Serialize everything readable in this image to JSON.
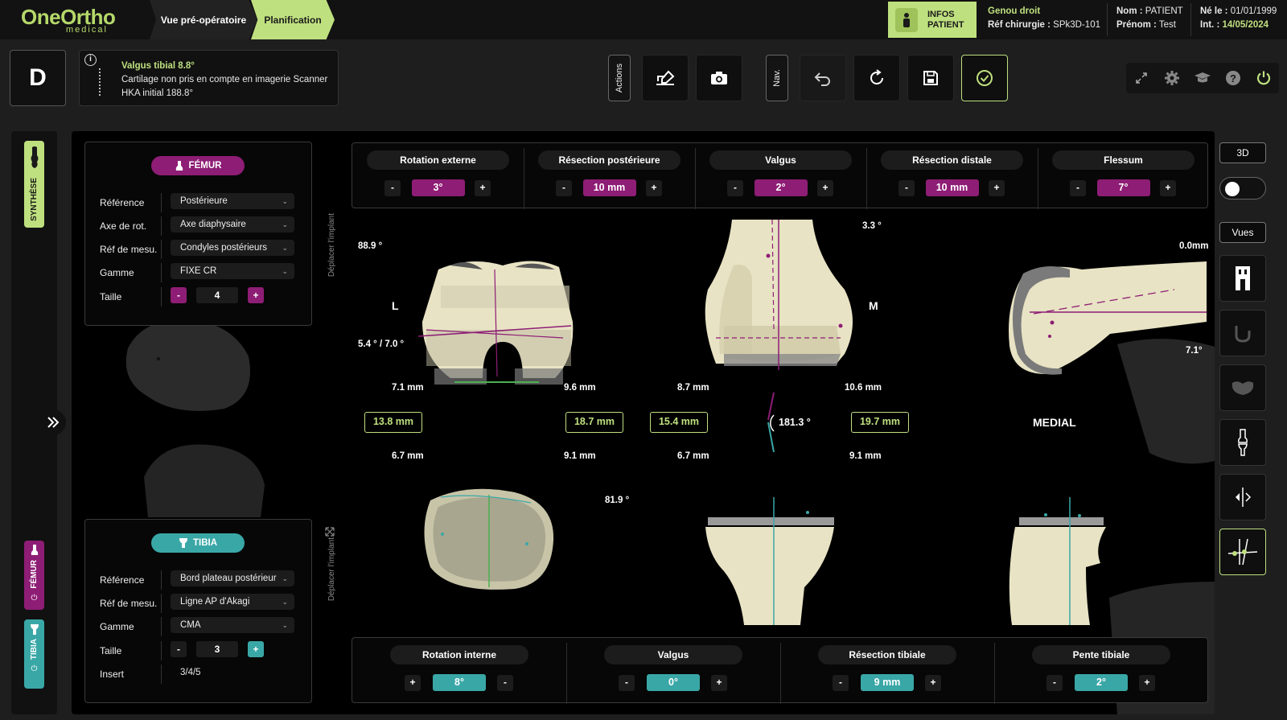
{
  "header": {
    "logo": "OneOrtho",
    "logo_sub": "medical",
    "tabs": [
      {
        "label": "Vue pré-opératoire",
        "active": false
      },
      {
        "label": "Planification",
        "active": true
      }
    ],
    "infos_patient": "INFOS\nPATIENT",
    "procedure": "Genou droit",
    "ref_label": "Réf chirurgie :",
    "ref_value": "SPk3D-101",
    "nom_label": "Nom :",
    "nom_value": "PATIENT",
    "prenom_label": "Prénom :",
    "prenom_value": "Test",
    "ne_label": "Né le :",
    "ne_value": "01/01/1999",
    "int_label": "Int. :",
    "int_value": "14/05/2024"
  },
  "toolbar": {
    "side": "D",
    "alert": {
      "title": "Valgus tibial 8.8°",
      "line2": "Cartilage non pris en compte en imagerie Scanner",
      "line3": "HKA initial 188.8°"
    },
    "actions_label": "Actions",
    "nav_label": "Nav."
  },
  "sidebar": {
    "synthese": "SYNTHÈSE",
    "femur": "FÉMUR",
    "tibia": "TIBIA"
  },
  "femur_panel": {
    "title": "FÉMUR",
    "rows": [
      {
        "label": "Référence",
        "value": "Postérieure"
      },
      {
        "label": "Axe de rot.",
        "value": "Axe diaphysaire"
      },
      {
        "label": "Réf de mesu.",
        "value": "Condyles postérieurs"
      },
      {
        "label": "Gamme",
        "value": "FIXE CR"
      }
    ],
    "size_label": "Taille",
    "size_value": "4"
  },
  "tibia_panel": {
    "title": "TIBIA",
    "rows": [
      {
        "label": "Référence",
        "value": "Bord plateau postérieur"
      },
      {
        "label": "Réf de mesu.",
        "value": "Ligne AP d'Akagi"
      },
      {
        "label": "Gamme",
        "value": "CMA"
      }
    ],
    "size_label": "Taille",
    "size_value": "3",
    "insert_label": "Insert",
    "insert_value": "3/4/5"
  },
  "femur_controls": [
    {
      "title": "Rotation externe",
      "value": "3°"
    },
    {
      "title": "Résection postérieure",
      "value": "10 mm"
    },
    {
      "title": "Valgus",
      "value": "2°"
    },
    {
      "title": "Résection distale",
      "value": "10 mm"
    },
    {
      "title": "Flessum",
      "value": "7°"
    }
  ],
  "tibia_controls": [
    {
      "title": "Rotation interne",
      "value": "8°"
    },
    {
      "title": "Valgus",
      "value": "0°"
    },
    {
      "title": "Résection tibiale",
      "value": "9 mm"
    },
    {
      "title": "Pente tibiale",
      "value": "2°"
    }
  ],
  "viewport": {
    "move_implant": "Déplacer l'implant",
    "angle_top_left": "88.9 °",
    "angle_left_mid": "5.4 ° / 7.0 °",
    "label_L": "L",
    "label_M": "M",
    "angle_top_mid": "3.3 °",
    "gap_right": "0.0mm",
    "angle_right": "7.1°",
    "m1": "7.1 mm",
    "m2": "9.6 mm",
    "m3": "8.7 mm",
    "m4": "10.6 mm",
    "box1": "13.8 mm",
    "box2": "18.7 mm",
    "box3": "15.4 mm",
    "box4": "19.7 mm",
    "hka": "181.3 °",
    "medial": "MEDIAL",
    "m5": "6.7 mm",
    "m6": "9.1 mm",
    "m7": "6.7 mm",
    "m8": "9.1 mm",
    "angle_tibia": "81.9 °"
  },
  "right_panel": {
    "btn_3d": "3D",
    "btn_vues": "Vues"
  },
  "colors": {
    "accent_green": "#bfe07f",
    "femur_magenta": "#8e1d75",
    "tibia_teal": "#3aa7a7",
    "bone": "#e8e3c4"
  }
}
